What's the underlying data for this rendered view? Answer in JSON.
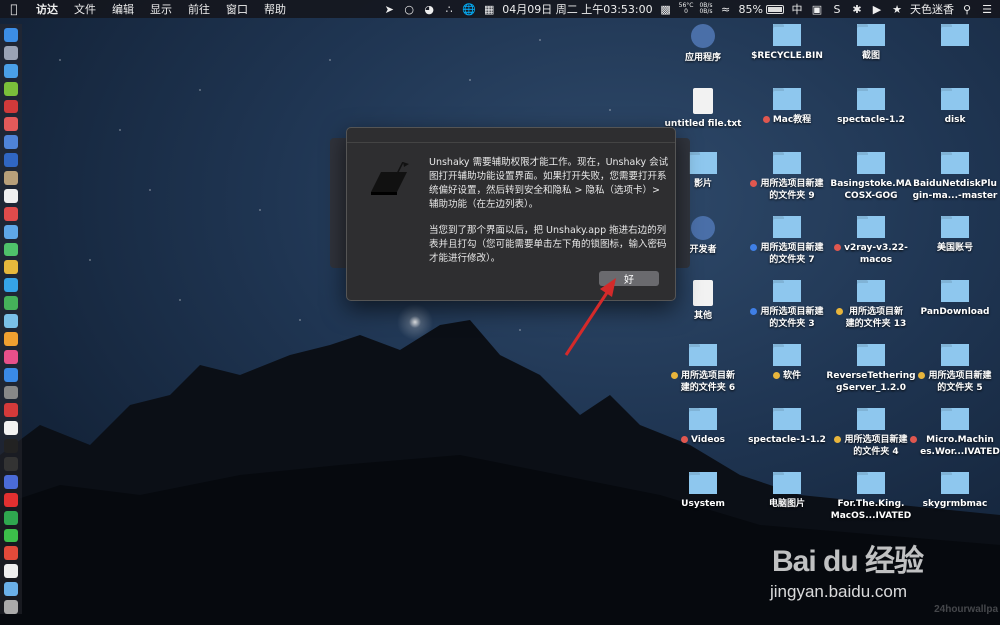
{
  "menubar": {
    "app_name": "访达",
    "menus": [
      "文件",
      "编辑",
      "显示",
      "前往",
      "窗口",
      "帮助"
    ],
    "status": {
      "temperature": "56°C",
      "temp_sub": "0",
      "net_up": "0B/s",
      "net_down": "0B/s",
      "clock": "04月09日 周二 上午03:53:00",
      "battery": "85%",
      "input_method": "中",
      "user_name": "天色迷香"
    }
  },
  "desktop": {
    "items": [
      {
        "label": "应用程序",
        "kind": "app",
        "tag": ""
      },
      {
        "label": "$RECYCLE.BIN",
        "kind": "folder",
        "tag": ""
      },
      {
        "label": "截图",
        "kind": "folder",
        "tag": ""
      },
      {
        "label": "",
        "kind": "folder",
        "tag": ""
      },
      {
        "label": "untitled file.txt",
        "kind": "file",
        "tag": ""
      },
      {
        "label": "Mac教程",
        "kind": "folder",
        "tag": "#e0574f"
      },
      {
        "label": "spectacle-1.2",
        "kind": "folder",
        "tag": ""
      },
      {
        "label": "disk",
        "kind": "folder",
        "tag": ""
      },
      {
        "label": "影片",
        "kind": "folder",
        "tag": ""
      },
      {
        "label": "用所选项目新建\n的文件夹 9",
        "kind": "folder",
        "tag": "#e0574f"
      },
      {
        "label": "Basingstoke.MA\nCOSX-GOG",
        "kind": "folder",
        "tag": ""
      },
      {
        "label": "BaiduNetdiskPlu\ngin-ma...-master",
        "kind": "folder",
        "tag": ""
      },
      {
        "label": "开发者",
        "kind": "app",
        "tag": ""
      },
      {
        "label": "用所选项目新建\n的文件夹 7",
        "kind": "folder",
        "tag": "#3f7fe6"
      },
      {
        "label": "v2ray-v3.22-\nmacos",
        "kind": "folder",
        "tag": "#e0574f"
      },
      {
        "label": "美国账号",
        "kind": "folder",
        "tag": ""
      },
      {
        "label": "其他",
        "kind": "file",
        "tag": ""
      },
      {
        "label": "用所选项目新建\n的文件夹 3",
        "kind": "folder",
        "tag": "#3f7fe6"
      },
      {
        "label": "用所选项目新\n建的文件夹 13",
        "kind": "folder",
        "tag": "#e8b53c"
      },
      {
        "label": "PanDownload",
        "kind": "folder",
        "tag": ""
      },
      {
        "label": "用所选项目新\n建的文件夹 6",
        "kind": "folder",
        "tag": "#e8b53c"
      },
      {
        "label": "软件",
        "kind": "folder",
        "tag": "#e8b53c"
      },
      {
        "label": "ReverseTethering\ngServer_1.2.0",
        "kind": "folder",
        "tag": ""
      },
      {
        "label": "用所选项目新建\n的文件夹 5",
        "kind": "folder",
        "tag": "#e8b53c"
      },
      {
        "label": "Videos",
        "kind": "folder",
        "tag": "#e0574f"
      },
      {
        "label": "spectacle-1-1.2",
        "kind": "folder",
        "tag": ""
      },
      {
        "label": "用所选项目新建\n的文件夹 4",
        "kind": "folder",
        "tag": "#e8b53c"
      },
      {
        "label": "Micro.Machin\nes.Wor...IVATED",
        "kind": "folder",
        "tag": "#e0574f"
      },
      {
        "label": "Usystem",
        "kind": "folder",
        "tag": ""
      },
      {
        "label": "电脑图片",
        "kind": "folder",
        "tag": ""
      },
      {
        "label": "For.The.King.\nMacOS...IVATED",
        "kind": "folder",
        "tag": ""
      },
      {
        "label": "skygrmbmac",
        "kind": "folder",
        "tag": ""
      }
    ]
  },
  "dialog": {
    "paragraph1": "Unshaky 需要辅助权限才能工作。现在，Unshaky 会试图打开辅助功能设置界面。如果打开失败，您需要打开系统偏好设置，然后转到安全和隐私 > 隐私（选项卡）> 辅助功能（在左边列表）。",
    "paragraph2": "当您到了那个界面以后，把 Unshaky.app 拖进右边的列表并且打勾（您可能需要单击左下角的锁图标，输入密码才能进行修改）。",
    "ok_label": "好"
  },
  "watermark": {
    "logo": "Bai du 经验",
    "url": "jingyan.baidu.com",
    "credit": "24hourwallpa"
  },
  "colors": {
    "folder_blue": "#8ec7ee",
    "folder_red": "#e0574f",
    "dialog_bg": "#2e2e30",
    "arrow_red": "#d42a2a"
  }
}
